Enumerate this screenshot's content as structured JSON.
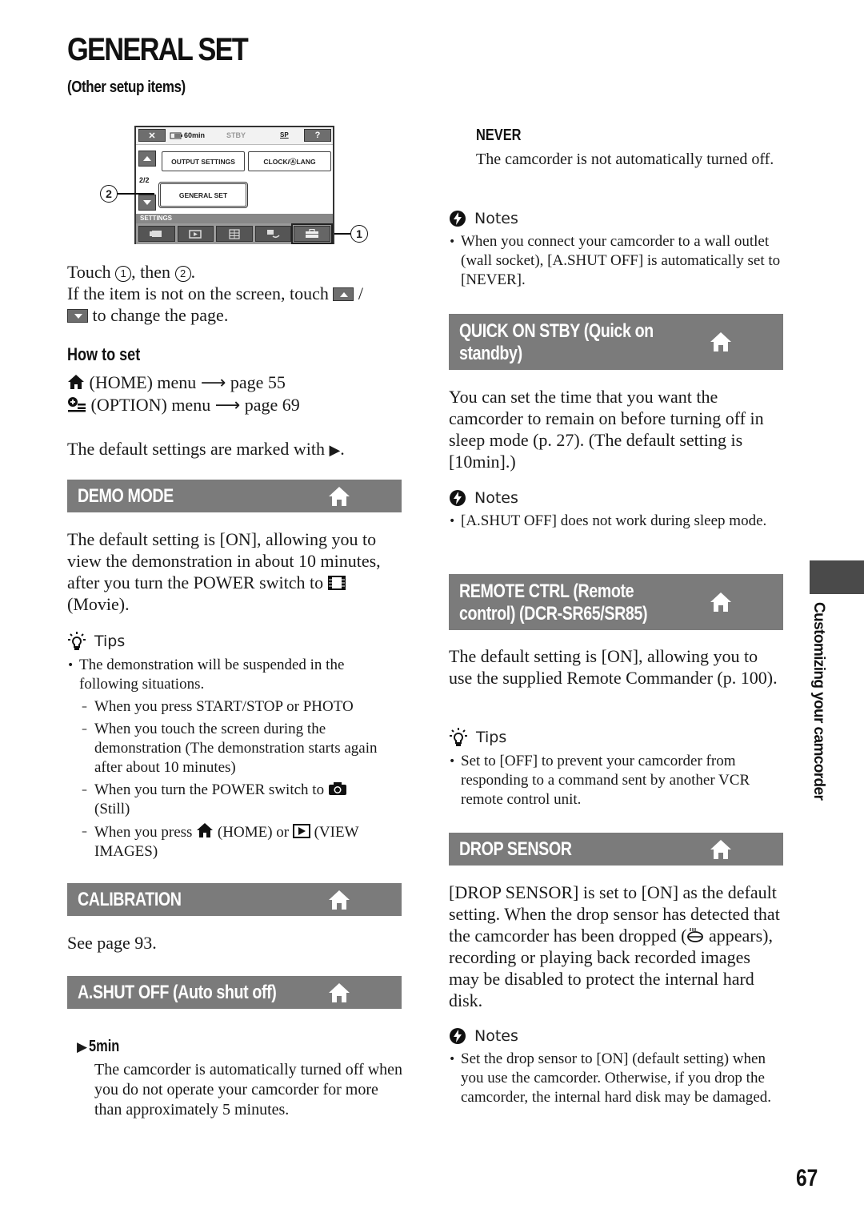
{
  "header": {
    "title": "GENERAL SET",
    "subtitle": "(Other setup items)"
  },
  "camcorder_screen": {
    "close_button": "✕",
    "battery": "60min",
    "status": "STBY",
    "quality": "SP",
    "help_button": "?",
    "page_indicator": "2/2",
    "items": [
      "OUTPUT SETTINGS",
      "CLOCK/ⒶLANG",
      "GENERAL SET"
    ],
    "category_label": "SETTINGS",
    "tab_icons": [
      "camera-icon",
      "view-images-icon",
      "list-icon",
      "settings-return-icon",
      "toolbox-icon"
    ],
    "callouts": [
      "1",
      "2"
    ]
  },
  "intro": {
    "touch_prefix": "Touch",
    "touch_mid": ", then",
    "touch_suffix": ".",
    "page_hint_prefix": "If the item is not on the screen, touch",
    "page_hint_sep": "/",
    "page_hint_suffix": "to change the page."
  },
  "how_to_set": {
    "heading": "How to set",
    "home_line": "(HOME) menu",
    "home_page": "page 55",
    "option_line": "(OPTION) menu",
    "option_page": "page 69",
    "default_note": "The default settings are marked with"
  },
  "sections": {
    "demo_mode": {
      "title": "DEMO MODE",
      "body_prefix": "The default setting is [ON], allowing you to view the demonstration in about 10 minutes, after you turn the POWER switch to",
      "body_suffix": "(Movie).",
      "tips_label": "Tips",
      "tip": "The demonstration will be suspended in the following situations.",
      "situations": [
        "When you press START/STOP or PHOTO",
        "When you touch the screen during the demonstration (The demonstration starts again after about 10 minutes)"
      ],
      "still_prefix": "When you turn the POWER switch to",
      "still_suffix": "(Still)",
      "home_prefix": "When you press",
      "home_mid": "(HOME) or",
      "home_suffix": "(VIEW IMAGES)"
    },
    "calibration": {
      "title": "CALIBRATION",
      "body": "See page 93."
    },
    "auto_shut_off": {
      "title": "A.SHUT OFF (Auto shut off)",
      "options": [
        {
          "label": "5min",
          "default": true,
          "description": "The camcorder is automatically turned off when you do not operate your camcorder for more than approximately 5 minutes."
        },
        {
          "label": "NEVER",
          "default": false,
          "description": "The camcorder is not automatically turned off."
        }
      ],
      "notes_label": "Notes",
      "note": "When you connect your camcorder to a wall outlet (wall socket), [A.SHUT OFF] is automatically set to [NEVER]."
    },
    "quick_on_stby": {
      "title_line1": "QUICK ON STBY (Quick on",
      "title_line2": "standby)",
      "body": "You can set the time that you want the camcorder to remain on before turning off in sleep mode (p. 27). (The default setting is [10min].)",
      "notes_label": "Notes",
      "note": "[A.SHUT OFF] does not work during sleep mode."
    },
    "remote_ctrl": {
      "title_line1": "REMOTE CTRL (Remote",
      "title_line2": "control) (DCR-SR65/SR85)",
      "body": "The default setting is [ON], allowing you to use the supplied Remote Commander (p. 100).",
      "tips_label": "Tips",
      "tip": "Set to [OFF] to prevent your camcorder from responding to a command sent by another VCR remote control unit."
    },
    "drop_sensor": {
      "title": "DROP SENSOR",
      "body_prefix": "[DROP SENSOR] is set to [ON] as the default setting. When the drop sensor has detected that the camcorder has been dropped (",
      "body_suffix": "appears), recording or playing back recorded images may be disabled to protect the internal hard disk.",
      "notes_label": "Notes",
      "note": "Set the drop sensor to [ON] (default setting) when you use the camcorder. Otherwise, if you drop the camcorder, the internal hard disk may be damaged."
    }
  },
  "sidebar": {
    "chapter_label": "Customizing your camcorder"
  },
  "footer": {
    "page_number": "67"
  },
  "colors": {
    "section_bar": "#7b7b7b",
    "side_tab": "#4a4a4a",
    "text": "#1a1a1a"
  }
}
